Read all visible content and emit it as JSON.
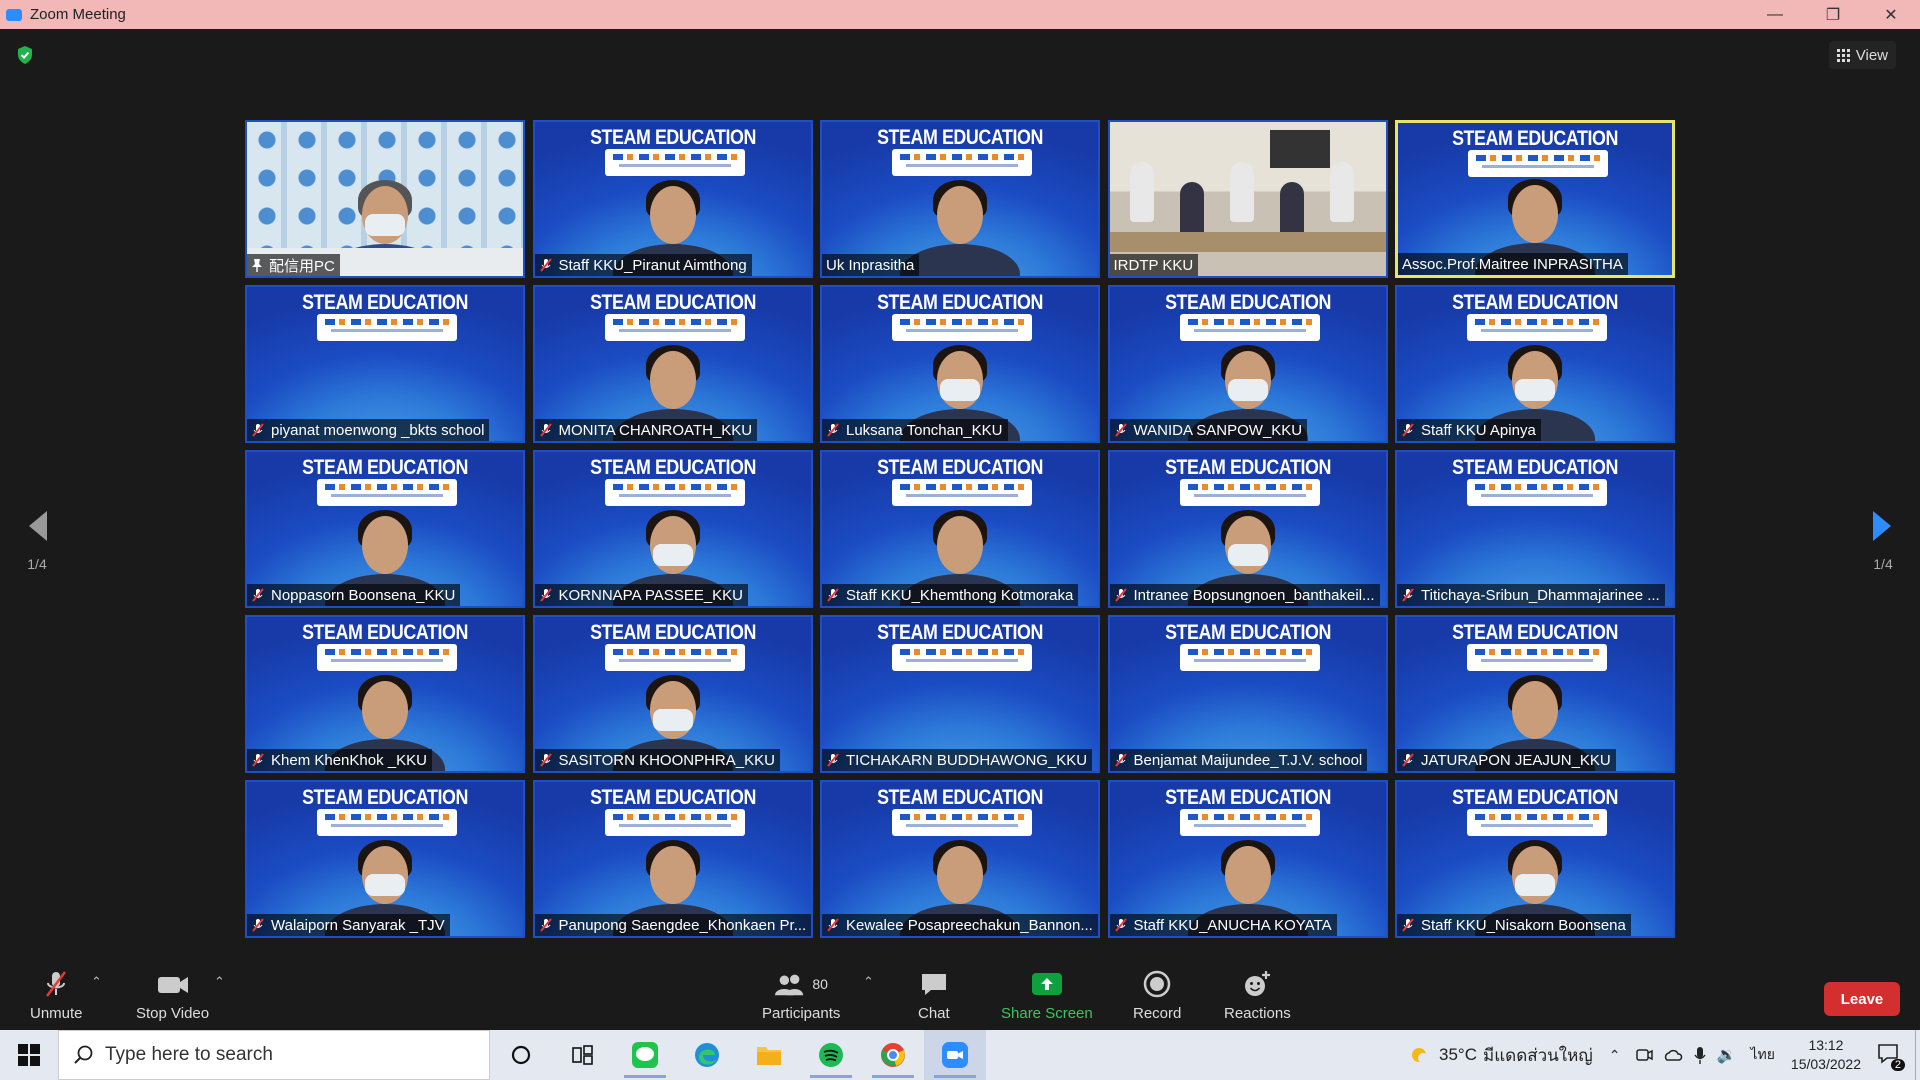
{
  "window": {
    "title": "Zoom Meeting"
  },
  "header": {
    "view_label": "View"
  },
  "navigation": {
    "prev_page": "1/4",
    "next_page": "1/4"
  },
  "participants": [
    {
      "name": "配信用PC",
      "icon": "pin-icon",
      "kind": "photo-room"
    },
    {
      "name": "Staff KKU_Piranut Aimthong",
      "icon": "mic-off-icon",
      "kind": "steam"
    },
    {
      "name": "Uk Inprasitha",
      "icon": "",
      "kind": "steam"
    },
    {
      "name": "IRDTP KKU",
      "icon": "",
      "kind": "photo-class"
    },
    {
      "name": "Assoc.Prof.Maitree INPRASITHA",
      "icon": "",
      "kind": "steam",
      "active": true
    },
    {
      "name": "piyanat moenwong _bkts school",
      "icon": "mic-off-icon",
      "kind": "steam-empty"
    },
    {
      "name": "MONITA CHANROATH_KKU",
      "icon": "mic-off-icon",
      "kind": "steam"
    },
    {
      "name": "Luksana Tonchan_KKU",
      "icon": "mic-off-icon",
      "kind": "steam-mask"
    },
    {
      "name": "WANIDA SANPOW_KKU",
      "icon": "mic-off-icon",
      "kind": "steam-mask"
    },
    {
      "name": "Staff KKU Apinya",
      "icon": "mic-off-icon",
      "kind": "steam-mask"
    },
    {
      "name": "Noppasorn Boonsena_KKU",
      "icon": "mic-off-icon",
      "kind": "steam"
    },
    {
      "name": "KORNNAPA PASSEE_KKU",
      "icon": "mic-off-icon",
      "kind": "steam-mask"
    },
    {
      "name": "Staff KKU_Khemthong Kotmoraka",
      "icon": "mic-off-icon",
      "kind": "steam"
    },
    {
      "name": "Intranee Bopsungnoen_banthakeil...",
      "icon": "mic-off-icon",
      "kind": "steam-mask"
    },
    {
      "name": "Titichaya-Sribun_Dhammajarinee ...",
      "icon": "mic-off-icon",
      "kind": "steam-empty"
    },
    {
      "name": "Khem KhenKhok _KKU",
      "icon": "mic-off-icon",
      "kind": "steam"
    },
    {
      "name": "SASITORN KHOONPHRA_KKU",
      "icon": "mic-off-icon",
      "kind": "steam-mask"
    },
    {
      "name": "TICHAKARN BUDDHAWONG_KKU",
      "icon": "mic-off-icon",
      "kind": "steam-empty"
    },
    {
      "name": "Benjamat Maijundee_T.J.V. school",
      "icon": "mic-off-icon",
      "kind": "steam-empty"
    },
    {
      "name": "JATURAPON JEAJUN_KKU",
      "icon": "mic-off-icon",
      "kind": "steam"
    },
    {
      "name": "Walaiporn Sanyarak _TJV",
      "icon": "mic-off-icon",
      "kind": "steam-mask"
    },
    {
      "name": "Panupong Saengdee_Khonkaen Pr...",
      "icon": "mic-off-icon",
      "kind": "steam"
    },
    {
      "name": "Kewalee Posapreechakun_Bannon...",
      "icon": "mic-off-icon",
      "kind": "steam"
    },
    {
      "name": "Staff KKU_ANUCHA KOYATA",
      "icon": "mic-off-icon",
      "kind": "steam"
    },
    {
      "name": "Staff KKU_Nisakorn Boonsena",
      "icon": "mic-off-icon",
      "kind": "steam-mask"
    }
  ],
  "tile_banner_text": "STEAM EDUCATION",
  "toolbar": {
    "unmute": "Unmute",
    "stop_video": "Stop Video",
    "participants": "Participants",
    "participants_count": "80",
    "chat": "Chat",
    "share_screen": "Share Screen",
    "record": "Record",
    "reactions": "Reactions",
    "leave": "Leave"
  },
  "taskbar": {
    "search_placeholder": "Type here to search",
    "weather": "35°C",
    "weather_desc": "มีแดดส่วนใหญ่",
    "lang": "ไทย",
    "time": "13:12",
    "date": "15/03/2022",
    "notification_count": "2"
  },
  "colors": {
    "accent": "#2d8cff",
    "share_green": "#0e9f3e",
    "leave_red": "#d32f2f",
    "active_border": "#e7e66a"
  }
}
